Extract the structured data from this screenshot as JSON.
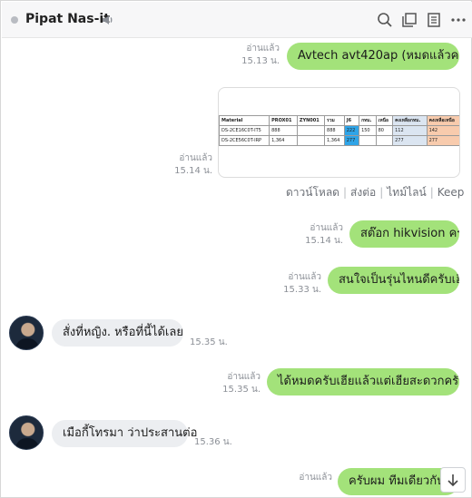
{
  "header": {
    "title": "Pipat Nas-it",
    "icons": [
      "speaker-icon",
      "search-icon",
      "copy-icon",
      "notes-icon",
      "more-icon"
    ]
  },
  "messages": [
    {
      "from": "me",
      "text": "Avtech avt420ap (หมดแล้วครับ)",
      "status": "อ่านแล้ว",
      "time": "15.13 น."
    },
    {
      "from": "me",
      "type": "image",
      "status": "อ่านแล้ว",
      "time": "15.14 น."
    },
    {
      "from": "me",
      "text": "สต๊อก hikvision ครับ",
      "status": "อ่านแล้ว",
      "time": "15.14 น."
    },
    {
      "from": "me",
      "text": "สนใจเป็นรุ่นไหนดีครับเฮีย",
      "status": "อ่านแล้ว",
      "time": "15.33 น."
    },
    {
      "from": "them",
      "text": "สั่งที่หญิง. หรือที่นี้ได้เลย",
      "time": "15.35 น."
    },
    {
      "from": "me",
      "text": "ได้หมดครับเฮียแล้วแต่เฮียสะดวกครับผม",
      "status": "อ่านแล้ว",
      "time": "15.35 น."
    },
    {
      "from": "them",
      "text": "เมือกี้โทรมา ว่าประสานต่อ",
      "time": "15.36 น."
    },
    {
      "from": "me",
      "text": "ครับผม ทีมเดียวกันครับ",
      "status": "อ่านแล้ว"
    }
  ],
  "image_actions": [
    "ดาวน์โหลด",
    "ส่งต่อ",
    "ไทม์ไลน์",
    "Keep"
  ],
  "sheet": {
    "headers": [
      "Material",
      "PROX01",
      "ZYN001",
      "รวม",
      "J6",
      "กทม.",
      "เหนือ",
      "คงเหลือกทม.",
      "คงเหลือเหนือ"
    ],
    "rows": [
      [
        "DS-2CE16C0T-IT5",
        "888",
        "",
        "888",
        "222",
        "150",
        "80",
        "112",
        "142"
      ],
      [
        "DS-2CE56C0T-IRP",
        "1,364",
        "",
        "1,364",
        "277",
        "",
        "",
        "277",
        "277"
      ]
    ]
  },
  "colors": {
    "outgoing_bubble": "#a3e27a",
    "incoming_bubble": "#eceef1",
    "highlight_blue": "#2fa4e7",
    "highlight_orange": "#f8cbad"
  }
}
